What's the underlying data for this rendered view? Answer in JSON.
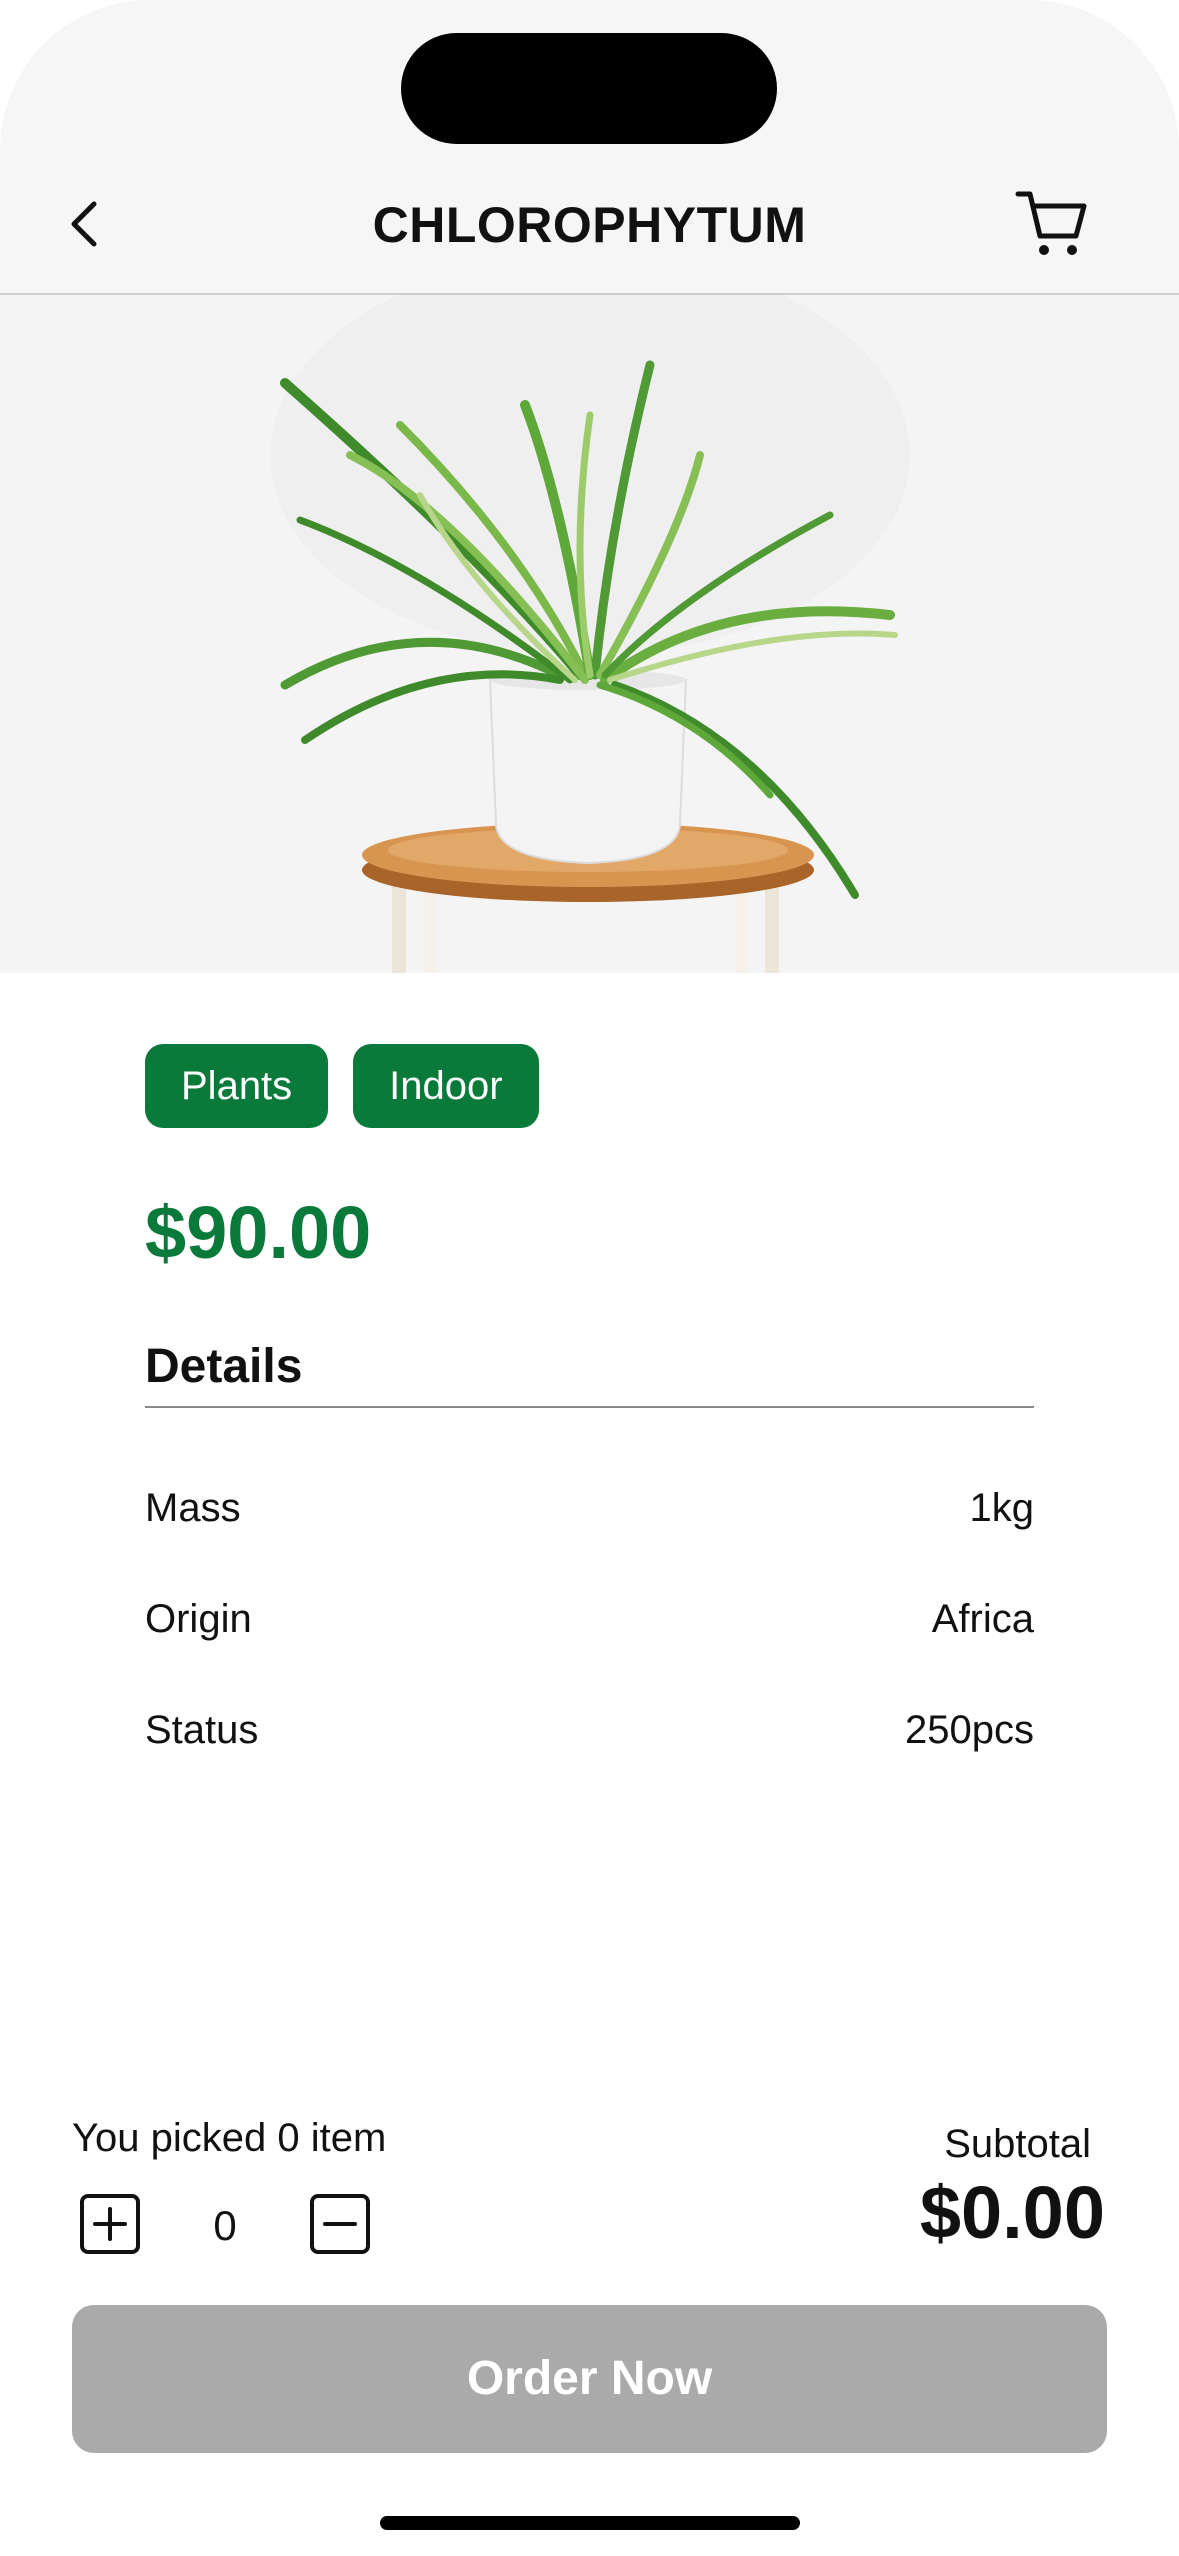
{
  "header": {
    "title": "CHLOROPHYTUM",
    "back_icon": "chevron-left-icon",
    "cart_icon": "cart-icon"
  },
  "product": {
    "image": "potted-spider-plant-on-wooden-stool",
    "tags": [
      "Plants",
      "Indoor"
    ],
    "price": "$90.00",
    "details_heading": "Details",
    "details": [
      {
        "label": "Mass",
        "value": "1kg"
      },
      {
        "label": "Origin",
        "value": "Africa"
      },
      {
        "label": "Status",
        "value": "250pcs"
      }
    ]
  },
  "order": {
    "picked_text": "You picked 0 item",
    "quantity": "0",
    "increment_icon": "plus-square-icon",
    "decrement_icon": "minus-square-icon",
    "subtotal_label": "Subtotal",
    "subtotal_value": "$0.00",
    "button_label": "Order Now"
  },
  "colors": {
    "brand_green": "#0a7a3a",
    "button_disabled": "#aaaaaa",
    "header_bg": "#f6f6f6"
  }
}
